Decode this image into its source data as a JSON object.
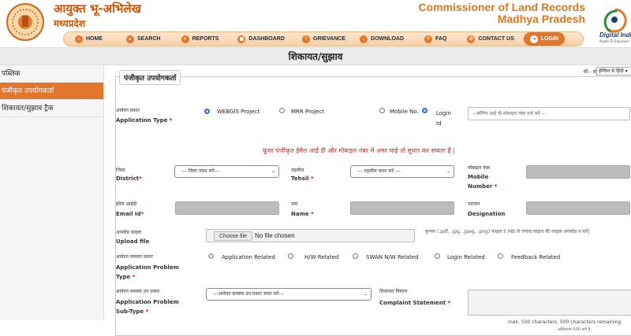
{
  "header": {
    "org_hi_line1": "आयुक्त भू-अभिलेख",
    "org_hi_line2": "मध्यप्रदेश",
    "org_en_line1": "Commissioner of Land Records",
    "org_en_line2": "Madhya Pradesh",
    "digital_india": "Digital India",
    "digital_india_tagline": "Power To Empower"
  },
  "nav": {
    "items": [
      {
        "label": "HOME",
        "icon": "home-icon"
      },
      {
        "label": "SEARCH",
        "icon": "search-icon"
      },
      {
        "label": "REPORTS",
        "icon": "reports-icon"
      },
      {
        "label": "DASHBOARD",
        "icon": "dashboard-icon"
      },
      {
        "label": "GRIEVANCE",
        "icon": "grievance-icon"
      },
      {
        "label": "DOWNLOAD",
        "icon": "download-icon"
      },
      {
        "label": "FAQ",
        "icon": "faq-icon"
      },
      {
        "label": "CONTACT US",
        "icon": "contact-icon"
      },
      {
        "label": "LOGIN",
        "icon": "login-icon"
      }
    ],
    "active": "LOGIN"
  },
  "page_title": "शिकायत/सुझाव",
  "sidebar": {
    "items": [
      {
        "label": "पब्लिक"
      },
      {
        "label": "पंजीकृत उपयोगकर्ता"
      },
      {
        "label": "शिकायत/सुझाव ट्रैक"
      }
    ],
    "active_index": 1
  },
  "keyboard_label": "की - बोर्ड",
  "language_select": "इंग्लिश से हिंदी",
  "form": {
    "legend": "पंजीकृत उपयोगकर्ता",
    "app_type": {
      "label_hi": "आवेदन प्रकार",
      "label_en": "Application Type",
      "options": [
        "WEBGIS Project",
        "MRR Project"
      ],
      "selected": "WEBGIS Project"
    },
    "login_mode": {
      "options": [
        "Mobile No.",
        "Login Id"
      ],
      "selected": "Login Id"
    },
    "login_input_placeholder": "--लॉगिन आई डी-मोबाइल नंबर दर्ज करें --",
    "warning": "यूजर पंजीकृत ईमेल आई डी और मोबाइल नंबर में अगर चाहे तो सुधार कर सकता हैं |",
    "district": {
      "label_hi": "जिला",
      "label_en": "District",
      "value": "--- जिला चयन करें---"
    },
    "tehsil": {
      "label_hi": "तहसील",
      "label_en": "Tehsil",
      "value": "--- तहसील चयन करें ---"
    },
    "mobile": {
      "label_hi": "मोबाइल नंबर",
      "label_en": "Mobile Number"
    },
    "email": {
      "label_hi": "ईमेल आईडी",
      "label_en": "Email Id"
    },
    "name": {
      "label_hi": "नाम",
      "label_en": "Name"
    },
    "designation": {
      "label_hi": "पदनाम",
      "label_en": "Designation"
    },
    "upload": {
      "label_hi": "अपलोड फ़ाइल",
      "label_en": "Upload file",
      "button": "Choose file",
      "status": "No file chosen",
      "hint": "कृपया (.pdf, .jpg, .jpeg, .png) फाइल 5 MB से ज्यादा साइज की फाइल अपलोड न करें|"
    },
    "problem_type": {
      "label_hi": "आवेदन समस्या प्रकार",
      "label_en": "Application Problem Type",
      "options": [
        "Application Related",
        "H/W Related",
        "SWAN N/W Related",
        "Login Related",
        "Feedback Related"
      ],
      "selected": "Application Related"
    },
    "problem_subtype": {
      "label_hi": "आवेदन समस्या उप प्रकार",
      "label_en": "Application Problem Sub-Type",
      "value": "---आवेदन समस्या उप प्रकार चयन करें---"
    },
    "complaint": {
      "label_hi": "शिकायत विवरण",
      "label_en": "Complaint Statement",
      "counter": "max. 500 characters. 500 characters remaining",
      "counter_hi": "अधिकतम 500 वर्ण है"
    }
  }
}
